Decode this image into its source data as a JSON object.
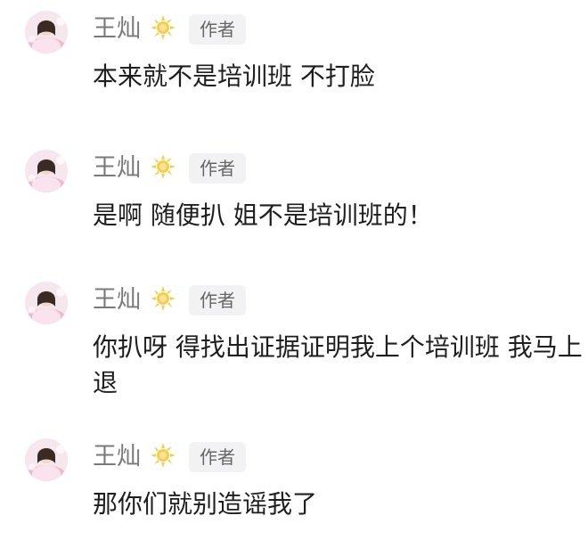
{
  "comments": [
    {
      "username": "王灿",
      "badge": "作者",
      "vip_icon": "sun-badge-icon",
      "text": "本来就不是培训班 不打脸"
    },
    {
      "username": "王灿",
      "badge": "作者",
      "vip_icon": "sun-badge-icon",
      "text": "是啊 随便扒 姐不是培训班的！"
    },
    {
      "username": "王灿",
      "badge": "作者",
      "vip_icon": "sun-badge-icon",
      "text": "你扒呀 得找出证据证明我上个培训班 我马上退"
    },
    {
      "username": "王灿",
      "badge": "作者",
      "vip_icon": "sun-badge-icon",
      "text": "那你们就别造谣我了"
    }
  ],
  "colors": {
    "username": "#7a7a7a",
    "badge_bg": "#f2f2f4",
    "badge_text": "#666666",
    "body_text": "#1e1e1e",
    "vip_icon": "#f6cf4a"
  }
}
